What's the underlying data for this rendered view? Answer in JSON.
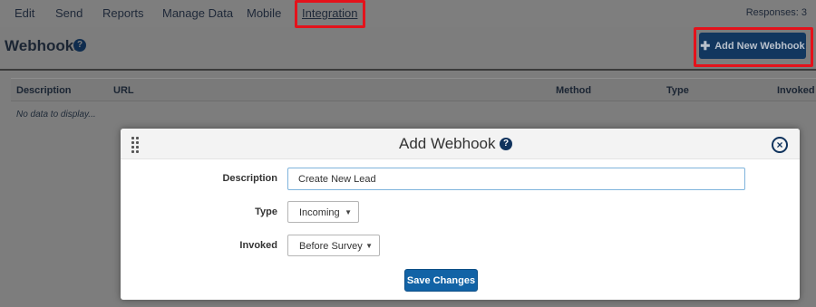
{
  "nav": {
    "items": [
      {
        "label": "Edit"
      },
      {
        "label": "Send"
      },
      {
        "label": "Reports"
      },
      {
        "label": "Manage Data"
      },
      {
        "label": "Mobile"
      },
      {
        "label": "Integration",
        "active": true
      }
    ],
    "responses": "Responses: 3"
  },
  "page": {
    "title": "Webhooks",
    "help_icon": "question-circle-icon",
    "add_button_label": "Add New Webhook",
    "add_button_icon": "plus-icon"
  },
  "table": {
    "columns": [
      "Description",
      "URL",
      "Method",
      "Type",
      "Invoked"
    ],
    "empty_text": "No data to display..."
  },
  "modal": {
    "title": "Add Webhook",
    "help_icon": "question-circle-icon",
    "close_icon": "close-circle-icon",
    "fields": {
      "description_label": "Description",
      "description_value": "Create New Lead",
      "type_label": "Type",
      "type_value": "Incoming",
      "invoked_label": "Invoked",
      "invoked_value": "Before Survey"
    },
    "save_label": "Save Changes"
  },
  "colors": {
    "highlight": "#e4121b",
    "primary_button": "#1263a6",
    "dark_navy": "#10335d"
  }
}
